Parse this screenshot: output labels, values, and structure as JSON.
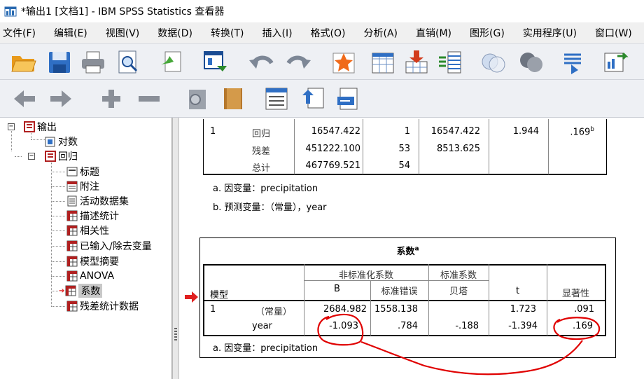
{
  "window": {
    "title": "*输出1 [文档1] - IBM SPSS Statistics 查看器"
  },
  "menu": [
    "文件(F)",
    "编辑(E)",
    "视图(V)",
    "数据(D)",
    "转换(T)",
    "插入(I)",
    "格式(O)",
    "分析(A)",
    "直销(M)",
    "图形(G)",
    "实用程序(U)",
    "窗口(W)"
  ],
  "toolbar1_icons": [
    "open-folder-icon",
    "save-icon",
    "print-icon",
    "print-preview-icon",
    "export-icon",
    "recall-dialog-icon",
    "undo-icon",
    "redo-icon",
    "goto-data-icon",
    "goto-case-icon",
    "goto-variable-icon",
    "variables-icon",
    "show-all-icon",
    "use-variable-sets-icon",
    "designate-window-icon",
    "select-last-output-icon"
  ],
  "toolbar2_icons": [
    "promote-icon",
    "demote-icon",
    "expand-icon",
    "collapse-icon",
    "show-icon",
    "hide-icon",
    "insert-heading-icon",
    "insert-title-icon",
    "insert-text-icon"
  ],
  "nav": {
    "root": "输出",
    "log": "对数",
    "regression": "回归",
    "children": [
      "标题",
      "附注",
      "活动数据集",
      "描述统计",
      "相关性",
      "已输入/除去变量",
      "模型摘要",
      "ANOVA",
      "系数",
      "残差统计数据"
    ]
  },
  "anova": {
    "rows": [
      {
        "model": "1",
        "label": "回归",
        "ss": "16547.422",
        "df": "1",
        "ms": "16547.422",
        "f": "1.944",
        "sig": ".169",
        "sup": "b"
      },
      {
        "model": "",
        "label": "残差",
        "ss": "451222.100",
        "df": "53",
        "ms": "8513.625",
        "f": "",
        "sig": "",
        "sup": ""
      },
      {
        "model": "",
        "label": "总计",
        "ss": "467769.521",
        "df": "54",
        "ms": "",
        "f": "",
        "sig": "",
        "sup": ""
      }
    ],
    "note_a": "a. 因变量：precipitation",
    "note_b": "b. 预测变量：（常量），year"
  },
  "coef": {
    "title": "系数",
    "title_sup": "a",
    "h_unstd": "非标准化系数",
    "h_std": "标准系数",
    "h_model": "模型",
    "h_b": "B",
    "h_se": "标准错误",
    "h_beta": "贝塔",
    "h_t": "t",
    "h_sig": "显著性",
    "rows": [
      {
        "model": "1",
        "label": "（常量）",
        "b": "2684.982",
        "se": "1558.138",
        "beta": "",
        "t": "1.723",
        "sig": ".091"
      },
      {
        "model": "",
        "label": "year",
        "b": "-1.093",
        "se": ".784",
        "beta": "-.188",
        "t": "-1.394",
        "sig": ".169"
      }
    ],
    "note_a": "a. 因变量：precipitation"
  },
  "colors": {
    "annotation": "#e00000",
    "selected_arrow": "#e02020"
  }
}
